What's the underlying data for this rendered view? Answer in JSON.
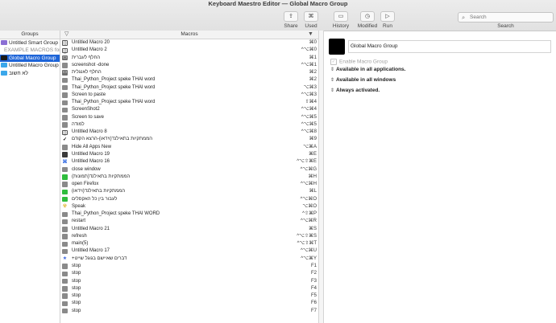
{
  "window": {
    "title": "Keyboard Maestro Editor — Global Macro Group"
  },
  "toolbar": {
    "share": "Share",
    "used": "Used",
    "history": "History",
    "modified": "Modified",
    "run": "Run",
    "search_label": "Search",
    "search_placeholder": "Search"
  },
  "columns": {
    "groups": "Groups",
    "macros": "Macros"
  },
  "groups": [
    {
      "label": "Untitled Smart Group",
      "color": "#8b6fd4",
      "selected": false,
      "dim": false
    },
    {
      "label": "EXAMPLE MACROS for...",
      "color": "",
      "selected": false,
      "dim": true
    },
    {
      "label": "Global Macro Group",
      "color": "#1a1a1a",
      "selected": true,
      "dim": false
    },
    {
      "label": "Untitled Macro Group",
      "color": "#3ba7ea",
      "selected": false,
      "dim": false
    },
    {
      "label": "לא חשוב",
      "color": "#3ba7ea",
      "selected": false,
      "dim": false
    }
  ],
  "macros": [
    {
      "icon": "macro-icon",
      "name": "Untitled Macro 20",
      "hotkey": "⌘0"
    },
    {
      "icon": "macro-icon",
      "name": "Untitled Macro 2",
      "hotkey": "^⌥⌘0"
    },
    {
      "icon": "keyboard-icon",
      "name": "החלף לעברית",
      "hotkey": "⌘1"
    },
    {
      "icon": "window-icon",
      "name": "screenshot -done",
      "hotkey": "^⌥⌘1"
    },
    {
      "icon": "keyboard-icon",
      "name": "החלף לאנגלית",
      "hotkey": "⌘2"
    },
    {
      "icon": "window-icon",
      "name": "Thai_Python_Project speke THAI word",
      "hotkey": "⌘2"
    },
    {
      "icon": "window-icon",
      "name": "Thai_Python_Project speke THAI word",
      "hotkey": "⌥⌘3"
    },
    {
      "icon": "window-icon",
      "name": "Screen to paste",
      "hotkey": "^⌥⌘3"
    },
    {
      "icon": "window-icon",
      "name": "Thai_Python_Project speke THAI word",
      "hotkey": "⇧⌘4"
    },
    {
      "icon": "window-icon",
      "name": "ScreenShot2",
      "hotkey": "^⌥⌘4"
    },
    {
      "icon": "window-icon",
      "name": "Screen to save",
      "hotkey": "^⌥⌘5"
    },
    {
      "icon": "window-icon",
      "name": "למודה",
      "hotkey": "^⌥⌘5"
    },
    {
      "icon": "macro-icon",
      "name": "Untitled Macro 8",
      "hotkey": "^⌥⌘8"
    },
    {
      "icon": "check-icon",
      "name": "הממתקיות בתאילנד(וידאו)-הרצא הקודם",
      "hotkey": "⌘9"
    },
    {
      "icon": "window-icon",
      "name": "Hide All Apps New",
      "hotkey": "⌥⌘A"
    },
    {
      "icon": "image-icon",
      "name": "Untitled Macro 19",
      "hotkey": "⌘E"
    },
    {
      "icon": "command-icon",
      "name": "Untitled Macro 16",
      "hotkey": "^⌥⇧⌘E"
    },
    {
      "icon": "window-icon",
      "name": "close window",
      "hotkey": "^⌥⌘G"
    },
    {
      "icon": "green-icon",
      "name": "הממתקיות בתאילנד(תמונות)",
      "hotkey": "⌘H"
    },
    {
      "icon": "window-icon",
      "name": "open Firefox",
      "hotkey": "^⌥⌘H"
    },
    {
      "icon": "green-icon",
      "name": "הממתקיות בתאילנד(וידאו)",
      "hotkey": "⌘L"
    },
    {
      "icon": "green-icon",
      "name": "לעבור בין כל האקסלים",
      "hotkey": "^⌥⌘O"
    },
    {
      "icon": "radioactive-icon",
      "name": "Speak",
      "hotkey": "⌥⌘O"
    },
    {
      "icon": "window-icon",
      "name": "Thai_Python_Project speke THAI WORD",
      "hotkey": "^⇧⌘P"
    },
    {
      "icon": "window-icon",
      "name": "restart",
      "hotkey": "^⌥⌘R"
    },
    {
      "icon": "window-icon",
      "name": "Untitled Macro 21",
      "hotkey": "⌘S"
    },
    {
      "icon": "window-icon",
      "name": "refresh",
      "hotkey": "^⌥⇧⌘S"
    },
    {
      "icon": "window-icon",
      "name": "main(5)",
      "hotkey": "^⌥⇧⌘T"
    },
    {
      "icon": "window-icon",
      "name": "Untitled Macro 17",
      "hotkey": "^⌥⌘U"
    },
    {
      "icon": "star-icon",
      "name": "+דברים שאיישם בגוגל שייט",
      "hotkey": "^⌥⌘Y"
    },
    {
      "icon": "window-icon",
      "name": "stop",
      "hotkey": "F1"
    },
    {
      "icon": "window-icon",
      "name": "stop",
      "hotkey": "F2"
    },
    {
      "icon": "window-icon",
      "name": "stop",
      "hotkey": "F3"
    },
    {
      "icon": "window-icon",
      "name": "stop",
      "hotkey": "F4"
    },
    {
      "icon": "window-icon",
      "name": "stop",
      "hotkey": "F5"
    },
    {
      "icon": "window-icon",
      "name": "stop",
      "hotkey": "F6"
    },
    {
      "icon": "window-icon",
      "name": "stop",
      "hotkey": "F7"
    }
  ],
  "detail": {
    "group_name": "Global Macro Group",
    "enable_label": "Enable Macro Group",
    "availability": "Available in all applications.",
    "windows": "Available in all windows",
    "activation": "Always activated."
  }
}
